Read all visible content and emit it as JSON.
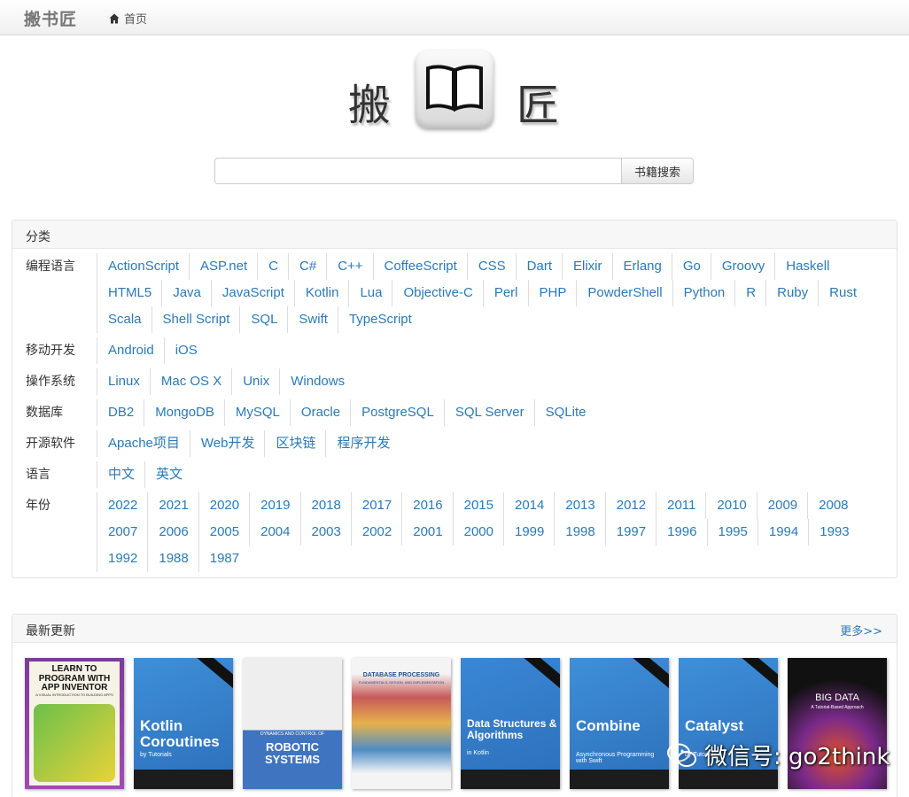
{
  "navbar": {
    "brand": "搬书匠",
    "home_label": "首页"
  },
  "logo": {
    "left_char": "搬",
    "right_char": "匠",
    "icon": "open-book-icon"
  },
  "search": {
    "input_value": "",
    "button_label": "书籍搜索"
  },
  "categories": {
    "title": "分类",
    "groups": [
      {
        "label": "编程语言",
        "items": [
          "ActionScript",
          "ASP.net",
          "C",
          "C#",
          "C++",
          "CoffeeScript",
          "CSS",
          "Dart",
          "Elixir",
          "Erlang",
          "Go",
          "Groovy",
          "Haskell",
          "HTML5",
          "Java",
          "JavaScript",
          "Kotlin",
          "Lua",
          "Objective-C",
          "Perl",
          "PHP",
          "PowderShell",
          "Python",
          "R",
          "Ruby",
          "Rust",
          "Scala",
          "Shell Script",
          "SQL",
          "Swift",
          "TypeScript"
        ]
      },
      {
        "label": "移动开发",
        "items": [
          "Android",
          "iOS"
        ]
      },
      {
        "label": "操作系统",
        "items": [
          "Linux",
          "Mac OS X",
          "Unix",
          "Windows"
        ]
      },
      {
        "label": "数据库",
        "items": [
          "DB2",
          "MongoDB",
          "MySQL",
          "Oracle",
          "PostgreSQL",
          "SQL Server",
          "SQLite"
        ]
      },
      {
        "label": "开源软件",
        "items": [
          "Apache项目",
          "Web开发",
          "区块链",
          "程序开发"
        ]
      },
      {
        "label": "语言",
        "items": [
          "中文",
          "英文"
        ]
      },
      {
        "label": "年份",
        "items": [
          "2022",
          "2021",
          "2020",
          "2019",
          "2018",
          "2017",
          "2016",
          "2015",
          "2014",
          "2013",
          "2012",
          "2011",
          "2010",
          "2009",
          "2008",
          "2007",
          "2006",
          "2005",
          "2004",
          "2003",
          "2002",
          "2001",
          "2000",
          "1999",
          "1998",
          "1997",
          "1996",
          "1995",
          "1994",
          "1993",
          "1992",
          "1988",
          "1987"
        ]
      }
    ]
  },
  "latest": {
    "title": "最新更新",
    "more_label": "更多>>",
    "books": [
      {
        "cover_text": "LEARN TO PROGRAM WITH APP INVENTOR",
        "sub": "A VISUAL INTRODUCTION TO BUILDING APPS",
        "bg": "#8e3fa0",
        "fg": "#1a1a1a"
      },
      {
        "cover_text": "Kotlin Coroutines",
        "sub": "by Tutorials",
        "bg": "#3f8fd9",
        "fg": "#ffffff"
      },
      {
        "cover_text": "ROBOTIC SYSTEMS",
        "sub": "DYNAMICS AND CONTROL OF",
        "bg": "#ececec",
        "fg": "#ffffff"
      },
      {
        "cover_text": "DATABASE PROCESSING",
        "sub": "FUNDAMENTALS, DESIGN, AND IMPLEMENTATION",
        "bg": "#f4f4f4",
        "fg": "#1e4f8f"
      },
      {
        "cover_text": "Data Structures & Algorithms",
        "sub": "in Kotlin",
        "bg": "#3a87d6",
        "fg": "#ffffff"
      },
      {
        "cover_text": "Combine",
        "sub": "Asynchronous Programming with Swift",
        "bg": "#3f8fd9",
        "fg": "#ffffff"
      },
      {
        "cover_text": "Catalyst",
        "sub": "by Tutorials",
        "bg": "#3f8fd9",
        "fg": "#ffffff"
      },
      {
        "cover_text": "BIG DATA",
        "sub": "A Tutorial-Based Approach",
        "bg": "#111111",
        "fg": "#ffffff"
      }
    ]
  },
  "watermark": {
    "text": "微信号: go2think",
    "icon": "wechat-icon"
  }
}
